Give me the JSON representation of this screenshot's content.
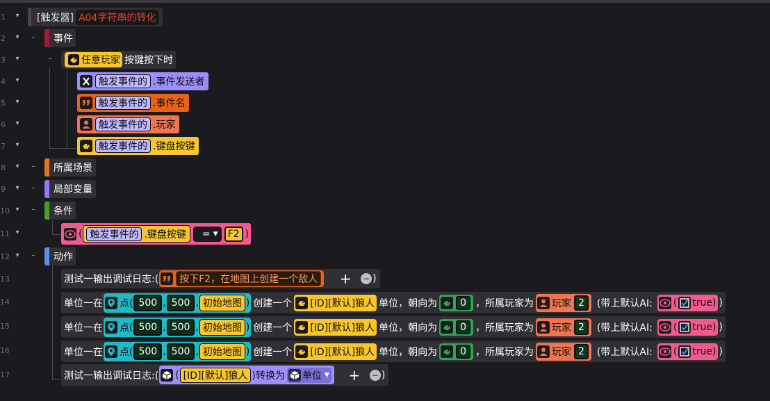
{
  "line_numbers": [
    "1",
    "2",
    "3",
    "4",
    "5",
    "6",
    "7",
    "8",
    "9",
    "10",
    "11",
    "12",
    "13",
    "14",
    "15",
    "16",
    "17"
  ],
  "toggles": {
    "expand": "▾",
    "collapse": "–"
  },
  "trigger": {
    "label": "[触发器]",
    "name": "A04字符串的转化"
  },
  "event_section": {
    "label": "事件"
  },
  "event": {
    "player": "任意玩家",
    "text": "按键按下时"
  },
  "event_params": [
    {
      "obj": "触发事件的",
      "prop": ".事件发送者",
      "icon": "x-icon"
    },
    {
      "obj": "触发事件的",
      "prop": ".事件名",
      "icon": "quote-icon"
    },
    {
      "obj": "触发事件的",
      "prop": ".玩家",
      "icon": "person-icon"
    },
    {
      "obj": "触发事件的",
      "prop": ".键盘按键",
      "icon": "creature-icon"
    }
  ],
  "scene_section": {
    "label": "所属场景"
  },
  "vars_section": {
    "label": "局部变量"
  },
  "cond_section": {
    "label": "条件"
  },
  "condition": {
    "open": "(",
    "obj": "触发事件的",
    "prop": ".键盘按键",
    "op": "=",
    "value": "F2",
    "close": ")"
  },
  "action_section": {
    "label": "动作"
  },
  "actions": {
    "log1": {
      "prefix": "测试一输出调试日志:(",
      "value": "按下F2，在地图上创建一个敌人",
      "suffix": ")"
    },
    "spawn_rows": [
      {
        "prefix": "单位一在",
        "point": "点(",
        "x": "500",
        "y": "500",
        "map": "初始地图",
        "create": "创建一个",
        "unit": "[ID][默认]狼人",
        "face": "单位，朝向为",
        "angle": "0",
        "owner": "，所属玩家为",
        "player": "玩家",
        "player_id": "2",
        "ai": "(带上默认AI:",
        "ai_value": "true"
      },
      {
        "prefix": "单位一在",
        "point": "点(",
        "x": "500",
        "y": "500",
        "map": "初始地图",
        "create": "创建一个",
        "unit": "[ID][默认]狼人",
        "face": "单位，朝向为",
        "angle": "0",
        "owner": "，所属玩家为",
        "player": "玩家",
        "player_id": "2",
        "ai": "(带上默认AI:",
        "ai_value": "true"
      },
      {
        "prefix": "单位一在",
        "point": "点(",
        "x": "500",
        "y": "500",
        "map": "初始地图",
        "create": "创建一个",
        "unit": "[ID][默认]狼人",
        "face": "单位，朝向为",
        "angle": "0",
        "owner": "，所属玩家为",
        "player": "玩家",
        "player_id": "2",
        "ai": "(带上默认AI:",
        "ai_value": "true"
      }
    ],
    "log2": {
      "prefix": "测试一输出调试日志:(",
      "open": "(",
      "unit": "[ID][默认]狼人",
      "convert": ")转换为",
      "type": "单位",
      "suffix": ")"
    }
  },
  "buttons": {
    "add": "+",
    "remove": "−"
  },
  "colors": {
    "trigger_name": "#e0452b",
    "event": "#a8163f",
    "scene": "#e8751a",
    "vars": "#8b7cf0",
    "cond": "#4b9a2a",
    "action": "#5b8fe8",
    "creature_yellow": "#f7c52d",
    "param_purple": "#9d8ffb",
    "string_orange": "#e8621a",
    "player_salmon": "#f07450",
    "point_teal": "#22b8c4",
    "bool_pink": "#f05a8c",
    "number_green": "#2aa655"
  }
}
